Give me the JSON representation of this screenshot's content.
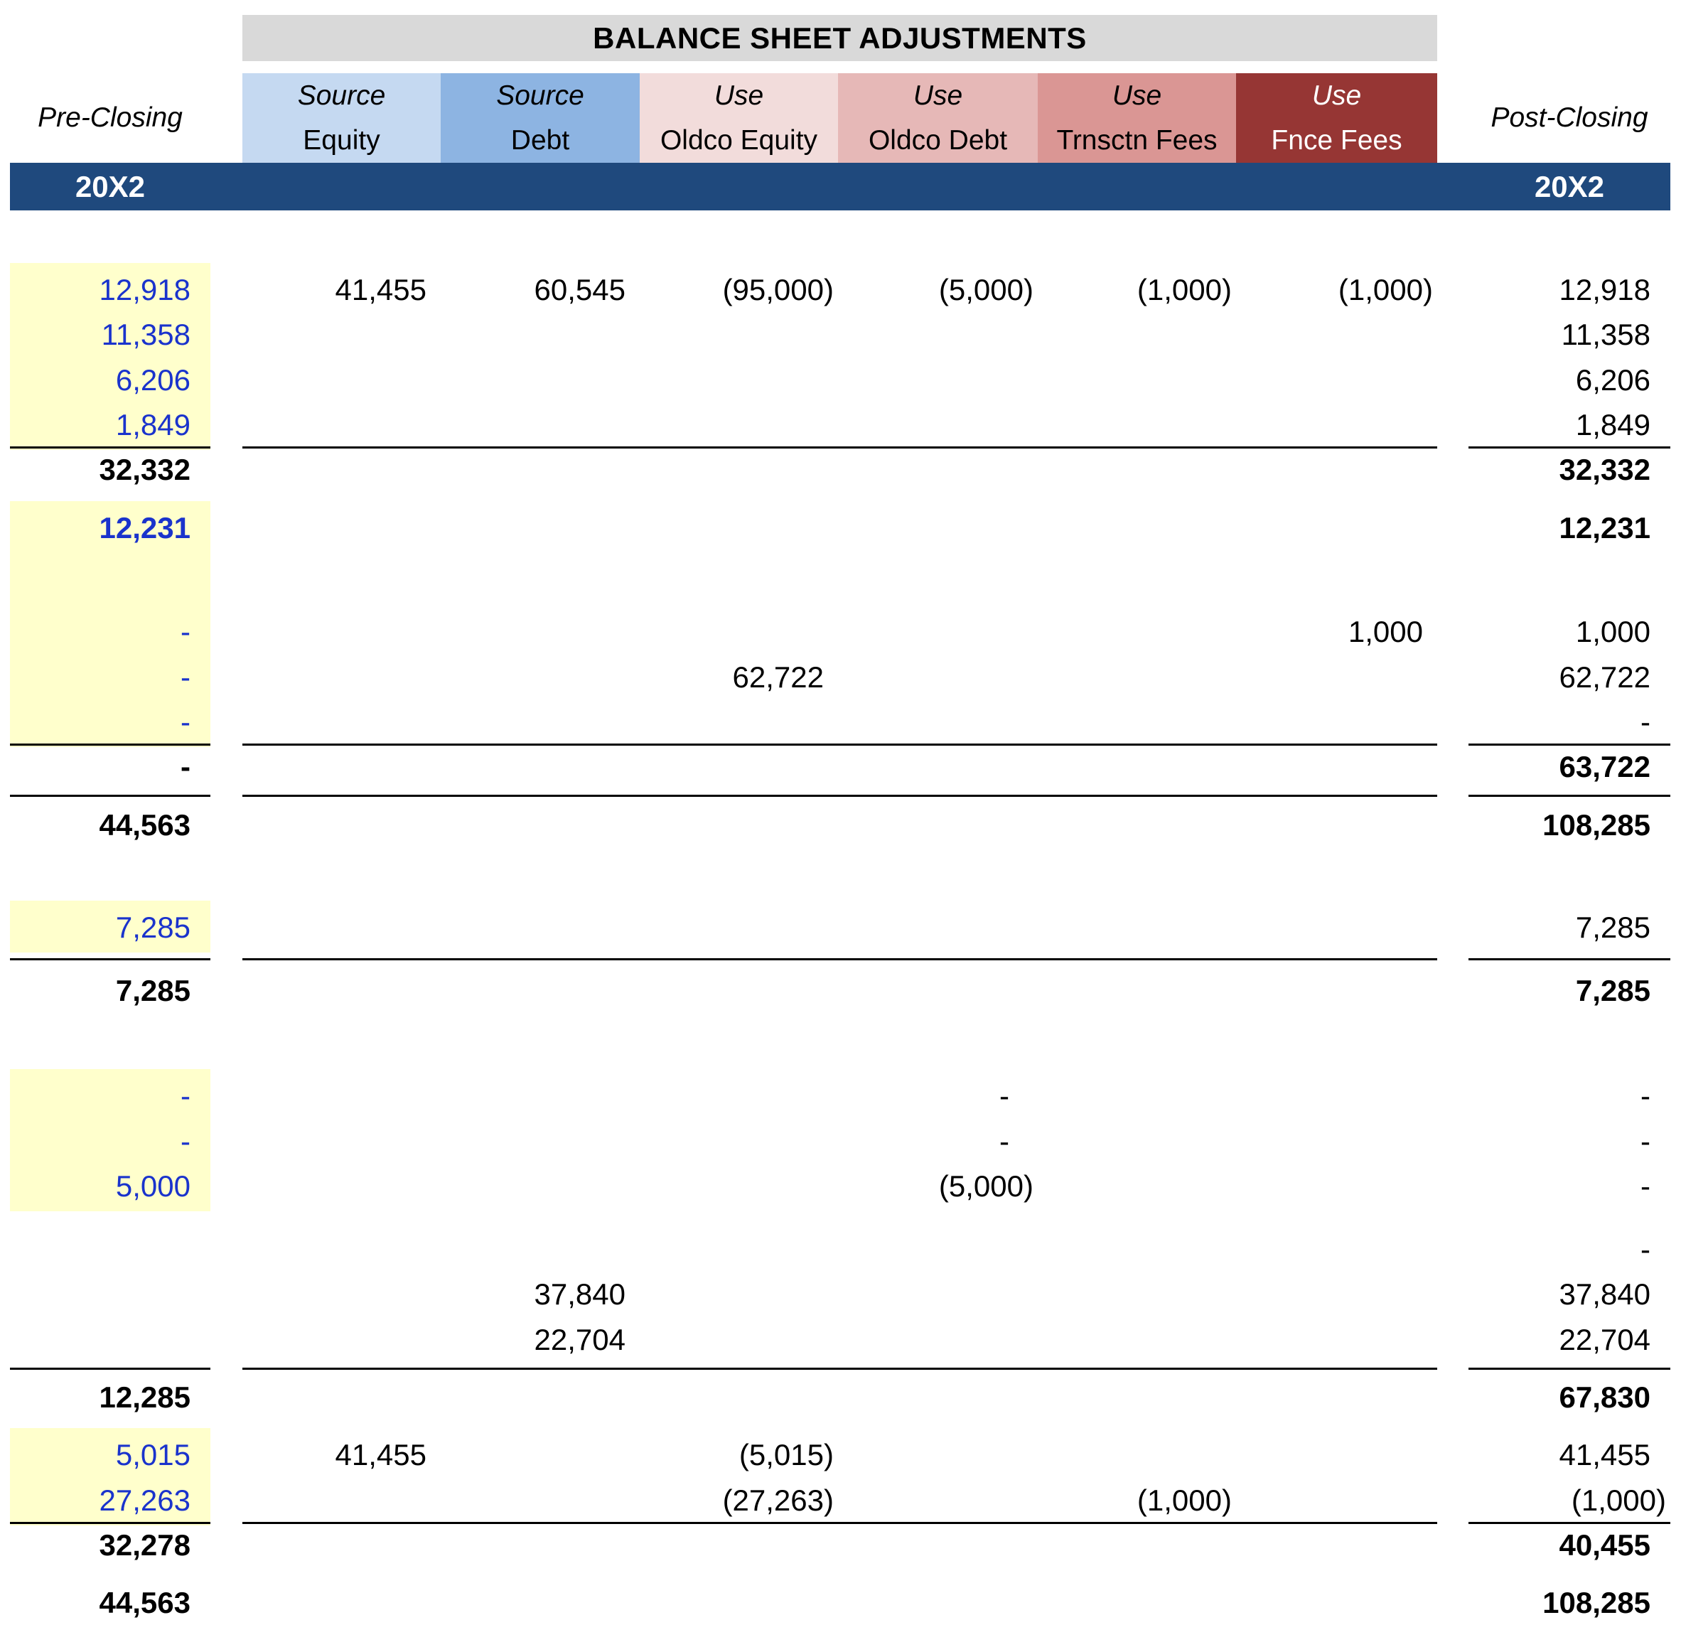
{
  "title": "BALANCE SHEET ADJUSTMENTS",
  "pre_closing_label": "Pre-Closing",
  "post_closing_label": "Post-Closing",
  "pre_year": "20X2",
  "post_year": "20X2",
  "adjustment_columns": [
    {
      "line1": "Source",
      "line2": "Equity",
      "color": "#c5d9f1",
      "text_color": "#000000"
    },
    {
      "line1": "Source",
      "line2": "Debt",
      "color": "#8db4e2",
      "text_color": "#000000"
    },
    {
      "line1": "Use",
      "line2": "Oldco Equity",
      "color": "#f2dcdb",
      "text_color": "#000000"
    },
    {
      "line1": "Use",
      "line2": "Oldco Debt",
      "color": "#e6b8b7",
      "text_color": "#000000"
    },
    {
      "line1": "Use",
      "line2": "Trnsctn Fees",
      "color": "#da9694",
      "text_color": "#000000"
    },
    {
      "line1": "Use",
      "line2": "Fnce Fees",
      "color": "#963634",
      "text_color": "#ffffff"
    }
  ],
  "colors": {
    "title_bg": "#d9d9d9",
    "year_bar": "#1f497d",
    "input_fill": "#ffffcc",
    "input_text": "#1a33cc"
  },
  "rows": [
    {
      "pre": "12,918",
      "pre_input": true,
      "adj": [
        "41,455",
        "60,545",
        "(95,000)",
        "(5,000)",
        "(1,000)",
        "(1,000)"
      ],
      "post": "12,918"
    },
    {
      "pre": "11,358",
      "pre_input": true,
      "adj": [
        "",
        "",
        "",
        "",
        "",
        ""
      ],
      "post": "11,358"
    },
    {
      "pre": "6,206",
      "pre_input": true,
      "adj": [
        "",
        "",
        "",
        "",
        "",
        ""
      ],
      "post": "6,206"
    },
    {
      "pre": "1,849",
      "pre_input": true,
      "adj": [
        "",
        "",
        "",
        "",
        "",
        ""
      ],
      "post": "1,849",
      "rule_below": true
    },
    {
      "pre": "32,332",
      "bold": true,
      "adj": [
        "",
        "",
        "",
        "",
        "",
        ""
      ],
      "post": "32,332"
    },
    {
      "pre": "12,231",
      "pre_input": true,
      "bold": true,
      "adj": [
        "",
        "",
        "",
        "",
        "",
        ""
      ],
      "post": "12,231"
    },
    {
      "pre": "-",
      "pre_input": true,
      "adj": [
        "",
        "",
        "",
        "",
        "",
        "1,000"
      ],
      "post": "1,000"
    },
    {
      "pre": "-",
      "pre_input": true,
      "adj": [
        "",
        "",
        "62,722",
        "",
        "",
        ""
      ],
      "post": "62,722"
    },
    {
      "pre": "-",
      "pre_input": true,
      "adj": [
        "",
        "",
        "",
        "",
        "",
        ""
      ],
      "post": "-",
      "rule_below": true
    },
    {
      "pre": "-",
      "bold": true,
      "adj": [
        "",
        "",
        "",
        "",
        "",
        ""
      ],
      "post": "63,722",
      "rule_below": true
    },
    {
      "pre": "44,563",
      "bold": true,
      "adj": [
        "",
        "",
        "",
        "",
        "",
        ""
      ],
      "post": "108,285"
    },
    {
      "pre": "7,285",
      "pre_input": true,
      "adj": [
        "",
        "",
        "",
        "",
        "",
        ""
      ],
      "post": "7,285",
      "rule_below": true
    },
    {
      "pre": "7,285",
      "bold": true,
      "adj": [
        "",
        "",
        "",
        "",
        "",
        ""
      ],
      "post": "7,285"
    },
    {
      "pre": "-",
      "pre_input": true,
      "adj": [
        "",
        "",
        "",
        "-",
        "",
        ""
      ],
      "post": "-"
    },
    {
      "pre": "-",
      "pre_input": true,
      "adj": [
        "",
        "",
        "",
        "-",
        "",
        ""
      ],
      "post": "-"
    },
    {
      "pre": "5,000",
      "pre_input": true,
      "adj": [
        "",
        "",
        "",
        "(5,000)",
        "",
        ""
      ],
      "post": "-"
    },
    {
      "pre": "",
      "adj": [
        "",
        "",
        "",
        "",
        "",
        ""
      ],
      "post": "-"
    },
    {
      "pre": "",
      "adj": [
        "",
        "37,840",
        "",
        "",
        "",
        ""
      ],
      "post": "37,840"
    },
    {
      "pre": "",
      "adj": [
        "",
        "22,704",
        "",
        "",
        "",
        ""
      ],
      "post": "22,704",
      "rule_below": true
    },
    {
      "pre": "12,285",
      "bold": true,
      "adj": [
        "",
        "",
        "",
        "",
        "",
        ""
      ],
      "post": "67,830"
    },
    {
      "pre": "5,015",
      "pre_input": true,
      "adj": [
        "41,455",
        "",
        "(5,015)",
        "",
        "",
        ""
      ],
      "post": "41,455"
    },
    {
      "pre": "27,263",
      "pre_input": true,
      "adj": [
        "",
        "",
        "(27,263)",
        "",
        "(1,000)",
        ""
      ],
      "post": "(1,000)",
      "rule_below": true
    },
    {
      "pre": "32,278",
      "bold": true,
      "adj": [
        "",
        "",
        "",
        "",
        "",
        ""
      ],
      "post": "40,455"
    },
    {
      "pre": "44,563",
      "bold": true,
      "adj": [
        "",
        "",
        "",
        "",
        "",
        ""
      ],
      "post": "108,285"
    }
  ]
}
